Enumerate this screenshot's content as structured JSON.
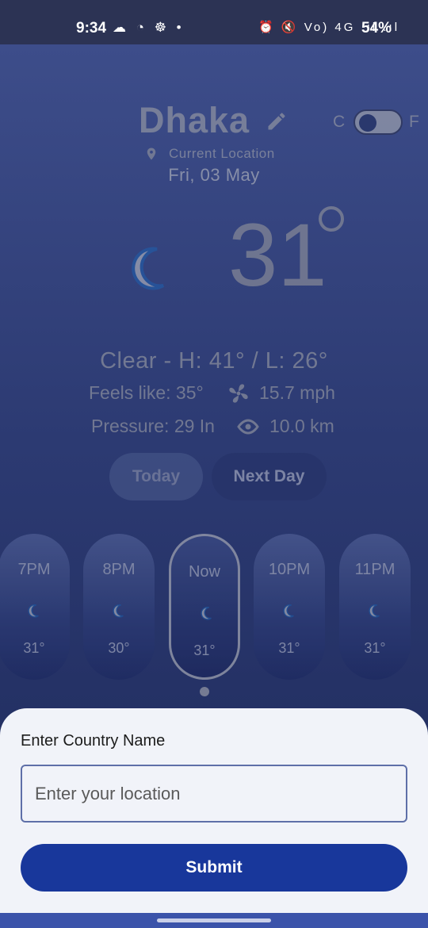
{
  "status": {
    "time": "9:34",
    "left_icons": "☁ ◔ ☸ •",
    "right_icons": "⏰ 🔇 Vo) 4G .ıl .ıl",
    "battery": "54%"
  },
  "header": {
    "city": "Dhaka",
    "unit_c": "C",
    "unit_f": "F",
    "location_label": "Current Location",
    "date": "Fri, 03 May"
  },
  "current": {
    "temp": "31",
    "condition_line": "Clear  -  H: 41° / L: 26°",
    "feels_like": "Feels like: 35°",
    "wind": "15.7 mph",
    "pressure": "Pressure: 29 In",
    "visibility": "10.0 km"
  },
  "tabs": {
    "today": "Today",
    "next_day": "Next Day"
  },
  "hourly": [
    {
      "time": "7PM",
      "temp": "31°"
    },
    {
      "time": "8PM",
      "temp": "30°"
    },
    {
      "time": "Now",
      "temp": "31°"
    },
    {
      "time": "10PM",
      "temp": "31°"
    },
    {
      "time": "11PM",
      "temp": "31°"
    }
  ],
  "sheet": {
    "label": "Enter Country Name",
    "placeholder": "Enter your location",
    "submit": "Submit"
  },
  "colors": {
    "accent": "#18379b",
    "background": "#2c3a72",
    "sheet": "#f1f3f9"
  }
}
